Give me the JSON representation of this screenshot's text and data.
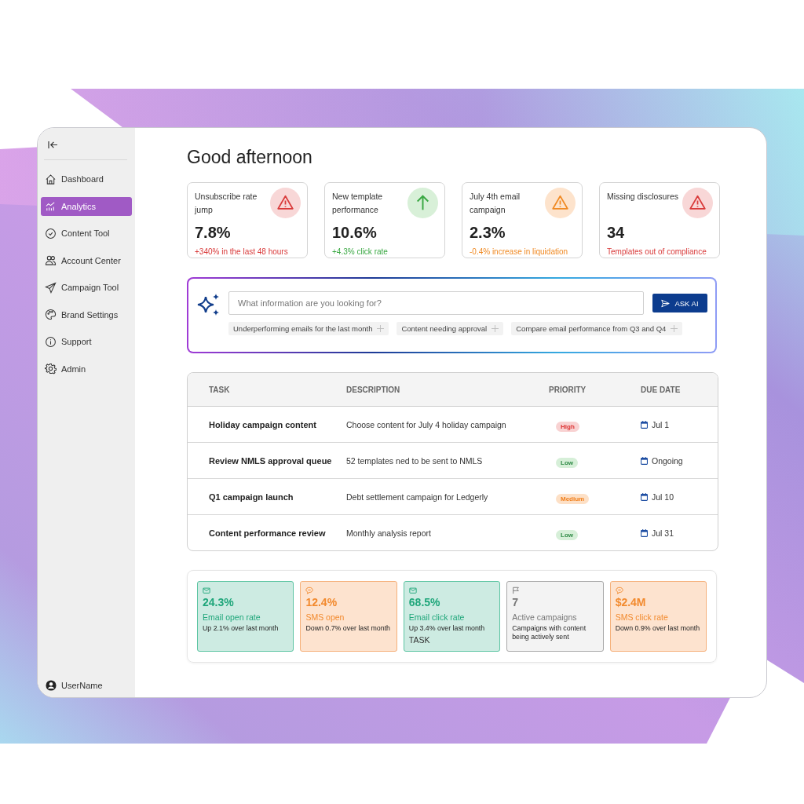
{
  "sidebar": {
    "items": [
      {
        "label": "Dashboard",
        "selected": false
      },
      {
        "label": "Analytics",
        "selected": true
      },
      {
        "label": "Content Tool",
        "selected": false
      },
      {
        "label": "Account Center",
        "selected": false
      },
      {
        "label": "Campaign Tool",
        "selected": false
      },
      {
        "label": "Brand Settings",
        "selected": false
      },
      {
        "label": "Support",
        "selected": false
      },
      {
        "label": "Admin",
        "selected": false
      }
    ],
    "user": "UserName"
  },
  "greeting": "Good afternoon",
  "stat_cards": [
    {
      "kind": "danger",
      "title": "Unsubscribe rate jump",
      "value": "7.8%",
      "note": "+340% in the last 48 hours"
    },
    {
      "kind": "success",
      "title": "New template performance",
      "value": "10.6%",
      "note": "+4.3% click rate"
    },
    {
      "kind": "warning",
      "title": "July 4th email campaign",
      "value": "2.3%",
      "note": "-0.4% increase in liquidation"
    },
    {
      "kind": "danger",
      "title": "Missing disclosures",
      "value": "34",
      "note": "Templates out of compliance"
    }
  ],
  "ask_ai": {
    "placeholder": "What information are you looking for?",
    "button": "ASK AI",
    "suggestions": [
      "Underperforming emails for the last month",
      "Content  needing approval",
      "Compare email performance from Q3 and Q4"
    ]
  },
  "table": {
    "columns": [
      "TASK",
      "DESCRIPTION",
      "PRIORITY",
      "DUE DATE"
    ],
    "rows": [
      {
        "task": "Holiday campaign content",
        "description": "Choose content for July 4 holiday campaign",
        "priority": "High",
        "kind": "high",
        "due": "Jul 1"
      },
      {
        "task": "Review NMLS approval queue",
        "description": "52 templates ned to be sent to NMLS",
        "priority": "Low",
        "kind": "low",
        "due": "Ongoing"
      },
      {
        "task": "Q1 campaign launch",
        "description": "Debt settlement campaign for Ledgerly",
        "priority": "Medium",
        "kind": "medium",
        "due": "Jul 10"
      },
      {
        "task": "Content performance review",
        "description": "Monthly analysis report",
        "priority": "Low",
        "kind": "low",
        "due": "Jul 31"
      }
    ]
  },
  "metrics": [
    {
      "kind": "email",
      "value": "24.3%",
      "label": "Email open rate",
      "note": "Up 2.1% over last month"
    },
    {
      "kind": "sms",
      "value": "12.4%",
      "label": "SMS open",
      "note": "Down 0.7% over last month"
    },
    {
      "kind": "email",
      "value": "68.5%",
      "label": "Email click rate",
      "note": "Up 3.4% over last month",
      "extra": "TASK"
    },
    {
      "kind": "campaign",
      "value": "7",
      "label": "Active campaigns",
      "note": "Campaigns with content being actively sent"
    },
    {
      "kind": "sms",
      "value": "$2.4M",
      "label": "SMS click rate",
      "note": "Down 0.9% over last month"
    }
  ]
}
